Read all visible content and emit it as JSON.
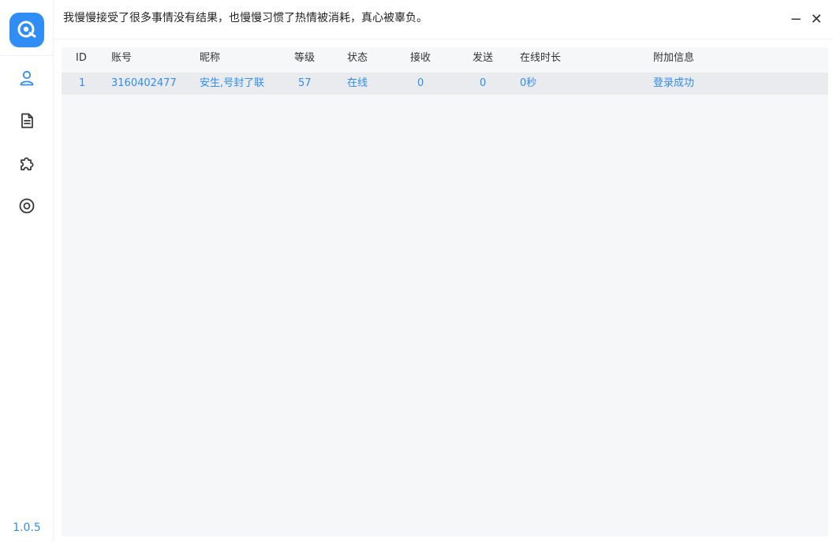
{
  "titlebar": {
    "title": "我慢慢接受了很多事情没有结果，也慢慢习惯了热情被消耗，真心被辜负。",
    "minimize_label": "−",
    "close_label": "✕"
  },
  "sidebar": {
    "version": "1.0.5",
    "items": [
      {
        "icon": "user-icon"
      },
      {
        "icon": "document-icon"
      },
      {
        "icon": "puzzle-icon"
      },
      {
        "icon": "settings-ring-icon"
      }
    ]
  },
  "table": {
    "columns": [
      "ID",
      "账号",
      "昵称",
      "等级",
      "状态",
      "接收",
      "发送",
      "在线时长",
      "附加信息"
    ],
    "rows": [
      [
        "1",
        "3160402477",
        "安生,号封了联",
        "57",
        "在线",
        "0",
        "0",
        "0秒",
        "登录成功"
      ]
    ]
  },
  "colors": {
    "accent": "#2f8df5",
    "row_selected": "#e9ebee",
    "panel_bg": "#f6f7f9"
  }
}
